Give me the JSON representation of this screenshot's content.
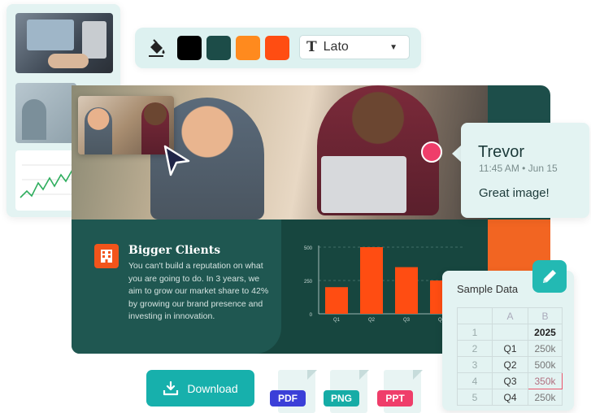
{
  "toolbar": {
    "fill_icon": "paint-bucket-icon",
    "swatches": [
      "#000000",
      "#1c4c48",
      "#ff8a1e",
      "#ff4d12"
    ],
    "font_icon": "text-T-icon",
    "font_value": "Lato"
  },
  "comment": {
    "name": "Trevor",
    "time": "11:45 AM • Jun 15",
    "text": "Great image!"
  },
  "slide": {
    "title": "Bigger Clients",
    "body": "You can't build a reputation on what you are going to do. In 3 years, we aim to grow our market share to 42% by growing our brand presence and investing in innovation."
  },
  "chart_data": {
    "type": "bar",
    "categories": [
      "Q1",
      "Q2",
      "Q3",
      "Q4"
    ],
    "values": [
      200,
      500,
      350,
      250
    ],
    "yticks": [
      0,
      250,
      500
    ],
    "ylim": [
      0,
      500
    ],
    "bar_color": "#ff4d12"
  },
  "sample_data": {
    "title": "Sample Data",
    "columns": [
      "A",
      "B"
    ],
    "rows": [
      {
        "n": "1",
        "a": "",
        "b": "2025"
      },
      {
        "n": "2",
        "a": "Q1",
        "b": "250k"
      },
      {
        "n": "3",
        "a": "Q2",
        "b": "500k"
      },
      {
        "n": "4",
        "a": "Q3",
        "b": "350k"
      },
      {
        "n": "5",
        "a": "Q4",
        "b": "250k"
      }
    ]
  },
  "download": {
    "label": "Download",
    "formats": [
      {
        "label": "PDF",
        "color": "#3b3fd8"
      },
      {
        "label": "PNG",
        "color": "#16aca6"
      },
      {
        "label": "PPT",
        "color": "#ef3e6a"
      }
    ]
  }
}
